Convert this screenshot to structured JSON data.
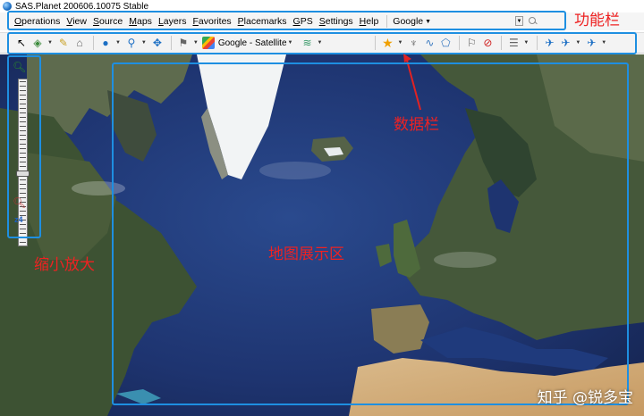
{
  "window": {
    "title": "SAS.Planet 200606.10075 Stable"
  },
  "menubar": {
    "items": [
      "Operations",
      "View",
      "Source",
      "Maps",
      "Layers",
      "Favorites",
      "Placemarks",
      "GPS",
      "Settings",
      "Help"
    ],
    "map_source": "Google"
  },
  "toolbar": {
    "map_type_label": "Google - Satellite"
  },
  "zoom": {
    "level_label": "z4",
    "level": 4
  },
  "annotations": {
    "function_bar": "功能栏",
    "data_bar": "数据栏",
    "zoom": "缩小放大",
    "map_area": "地图展示区"
  },
  "watermark": "知乎 @锐多宝",
  "colors": {
    "annotation_box": "#1e8fe1",
    "annotation_text": "#e22222"
  }
}
